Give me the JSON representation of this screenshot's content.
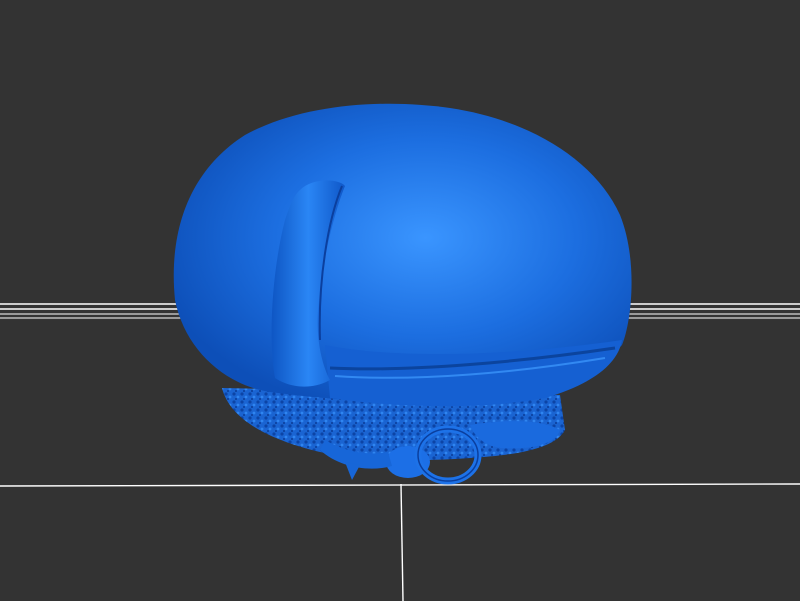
{
  "viewport": {
    "background_color": "#333333",
    "grid_color": "#ffffff",
    "model_color": "#1a6fe0",
    "model_highlight": "#3d9bff",
    "model_shadow": "#0b3f9e"
  }
}
